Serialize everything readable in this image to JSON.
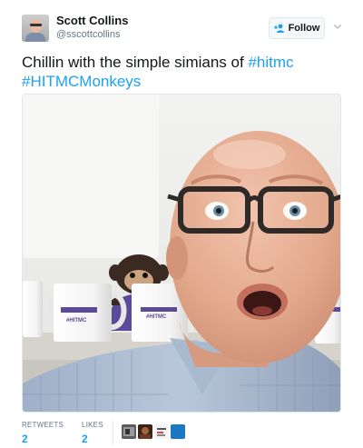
{
  "user": {
    "name": "Scott Collins",
    "handle": "@sscottcollins"
  },
  "follow_button": {
    "label": "Follow"
  },
  "tweet": {
    "text": "Chillin with the simple simians of",
    "hashtags": [
      "#hitmc",
      "#HITMCMonkeys"
    ]
  },
  "photo": {
    "mug_print": "#HITMC"
  },
  "stats": {
    "retweets_label": "RETWEETS",
    "retweets_count": "2",
    "likes_label": "LIKES",
    "likes_count": "2"
  },
  "colors": {
    "link": "#1da1f2",
    "muted": "#657786",
    "text": "#14171a",
    "border": "#e1e8ed"
  },
  "icons": {
    "follow": "person-add-icon",
    "more": "chevron-down-icon"
  }
}
